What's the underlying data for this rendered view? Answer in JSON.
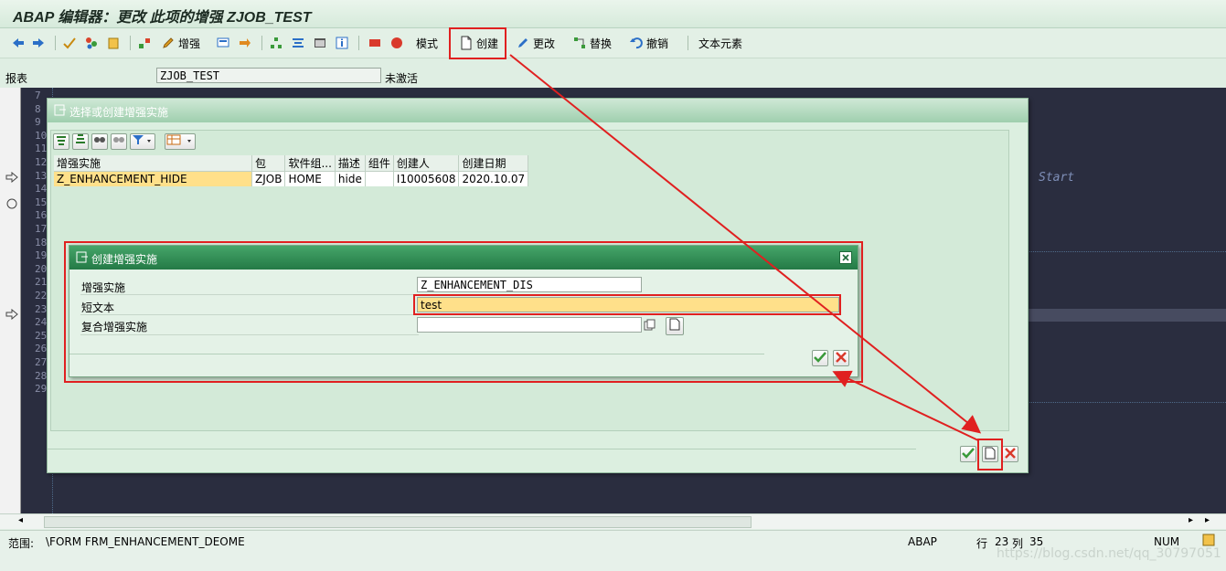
{
  "window": {
    "title": "ABAP 编辑器：更改 此项的增强 ZJOB_TEST"
  },
  "toolbar": {
    "enhance_label": "增强",
    "mode_label": "模式",
    "create_label": "创建",
    "change_label": "更改",
    "replace_label": "替换",
    "undo_label": "撤销",
    "textelements_label": "文本元素"
  },
  "report": {
    "label": "报表",
    "value": "ZJOB_TEST",
    "status": "未激活"
  },
  "editor": {
    "line_numbers": [
      "7",
      "8",
      "9",
      "10",
      "11",
      "12",
      "13",
      "14",
      "15",
      "16",
      "17",
      "18",
      "19",
      "20",
      "21",
      "22",
      "23",
      "24",
      "25",
      "26",
      "27",
      "28",
      "29"
    ],
    "start_text": "Start"
  },
  "dialog_select": {
    "title": "选择或创建增强实施",
    "columns": [
      "增强实施",
      "包",
      "软件组...",
      "描述",
      "组件",
      "创建人",
      "创建日期"
    ],
    "rows": [
      [
        "Z_ENHANCEMENT_HIDE",
        "ZJOB",
        "HOME",
        "hide",
        "",
        "I10005608",
        "2020.10.07"
      ]
    ]
  },
  "dialog_create": {
    "title": "创建增强实施",
    "fields": [
      {
        "label": "增强实施",
        "value": "Z_ENHANCEMENT_DIS"
      },
      {
        "label": "短文本",
        "value": "test"
      },
      {
        "label": "复合增强实施",
        "value": ""
      }
    ]
  },
  "status": {
    "scope_label": "范围:",
    "scope_value": "\\FORM FRM_ENHANCEMENT_DEOME",
    "language": "ABAP",
    "row_label": "行",
    "row_value": "23",
    "col_label": "列",
    "col_value": "35",
    "num": "NUM",
    "watermark": "https://blog.csdn.net/qq_30797051"
  },
  "colors": {
    "annotation_red": "#e02020",
    "editor_bg": "#2a2d3f",
    "selected_row": "#ffe08a"
  }
}
